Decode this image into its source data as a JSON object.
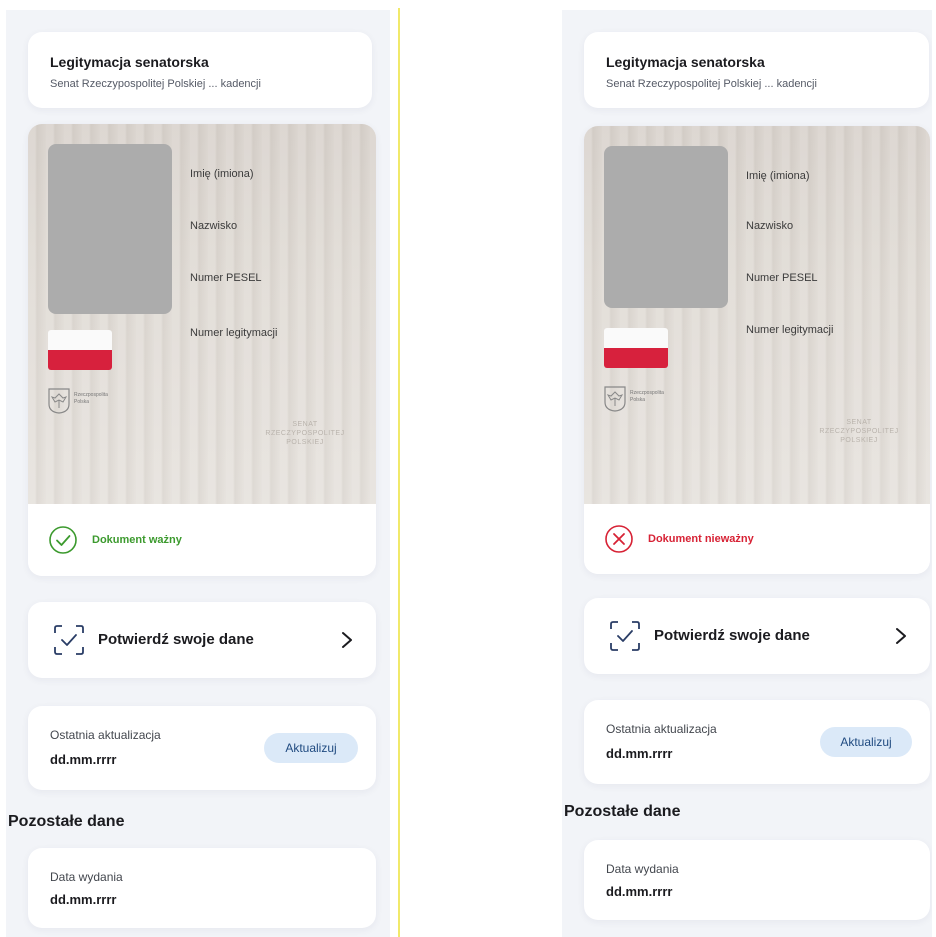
{
  "colors": {
    "valid_green": "#3c9a2e",
    "invalid_red": "#d72235",
    "flag_red": "#d7213d",
    "button_bg": "#dbe9f8",
    "button_text": "#1f4a80"
  },
  "screens": [
    {
      "title": "Legitymacja senatorska",
      "subtitle": "Senat Rzeczypospolitej Polskiej ... kadencji",
      "fields": [
        "Imię (imiona)",
        "Nazwisko",
        "Numer PESEL",
        "Numer legitymacji"
      ],
      "emblem_caption": "Rzeczpospolita Polska",
      "watermark": "SENAT RZECZYPOSPOLITEJ POLSKIEJ",
      "status": {
        "text": "Dokument ważny",
        "icon": "check-circle-icon",
        "state": "valid"
      },
      "confirm_label": "Potwierdź swoje dane",
      "update": {
        "label": "Ostatnia aktualizacja",
        "value": "dd.mm.rrrr",
        "button": "Aktualizuj"
      },
      "other_title": "Pozostałe dane",
      "issue": {
        "label": "Data wydania",
        "value": "dd.mm.rrrr"
      }
    },
    {
      "title": "Legitymacja senatorska",
      "subtitle": "Senat Rzeczypospolitej Polskiej ... kadencji",
      "fields": [
        "Imię (imiona)",
        "Nazwisko",
        "Numer PESEL",
        "Numer legitymacji"
      ],
      "emblem_caption": "Rzeczpospolita Polska",
      "watermark": "SENAT RZECZYPOSPOLITEJ POLSKIEJ",
      "status": {
        "text": "Dokument nieważny",
        "icon": "x-circle-icon",
        "state": "invalid"
      },
      "confirm_label": "Potwierdź swoje dane",
      "update": {
        "label": "Ostatnia aktualizacja",
        "value": "dd.mm.rrrr",
        "button": "Aktualizuj"
      },
      "other_title": "Pozostałe dane",
      "issue": {
        "label": "Data wydania",
        "value": "dd.mm.rrrr"
      }
    }
  ]
}
